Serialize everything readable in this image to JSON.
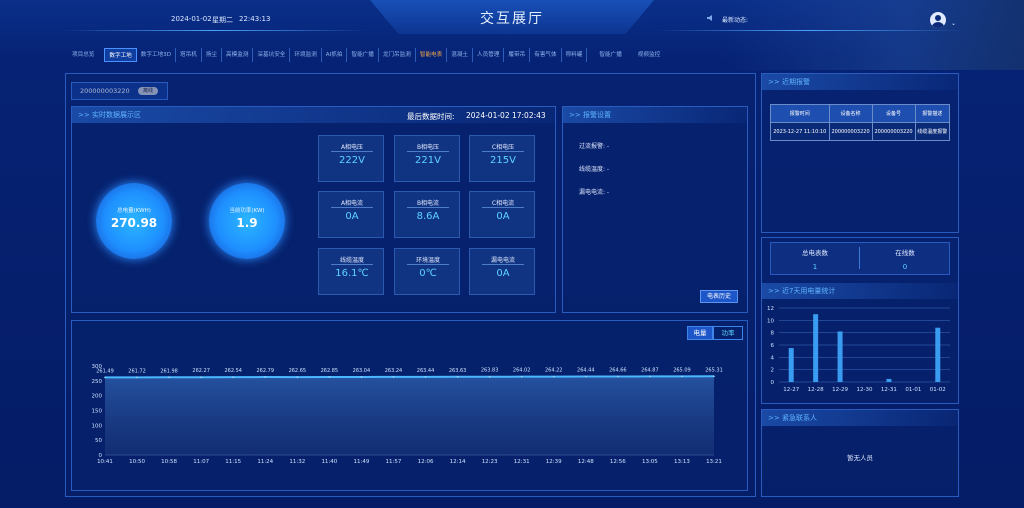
{
  "header": {
    "title": "交互展厅",
    "date": "2024-01-02",
    "weekday": "星期二",
    "time": "22:43:13",
    "news_label": "最新动态:"
  },
  "nav": {
    "items": [
      {
        "label": "项目总览",
        "state": "normal"
      },
      {
        "label": "数字工地",
        "state": "active"
      },
      {
        "label": "数字工地3D",
        "state": "normal"
      },
      {
        "label": "塔吊机",
        "state": "normal"
      },
      {
        "label": "扬尘",
        "state": "normal"
      },
      {
        "label": "高模监测",
        "state": "normal"
      },
      {
        "label": "深基坑安全",
        "state": "normal"
      },
      {
        "label": "环境监测",
        "state": "normal"
      },
      {
        "label": "AI抓拍",
        "state": "normal"
      },
      {
        "label": "智能广播",
        "state": "normal"
      },
      {
        "label": "龙门吊监测",
        "state": "normal"
      },
      {
        "label": "智能电表",
        "state": "orange"
      },
      {
        "label": "混凝土",
        "state": "normal"
      },
      {
        "label": "人员管理",
        "state": "normal"
      },
      {
        "label": "履带吊",
        "state": "normal"
      },
      {
        "label": "有害气体",
        "state": "normal"
      },
      {
        "label": "称料罐",
        "state": "normal"
      },
      {
        "label": "智能广播",
        "state": "plain"
      },
      {
        "label": "视频监控",
        "state": "plain"
      }
    ]
  },
  "device": {
    "id": "200000003220",
    "status": "离线"
  },
  "realtime": {
    "title": ">> 实时数据展示区",
    "last_time_label": "最后数据时间:",
    "last_time": "2024-01-02 17:02:43",
    "total_energy_label": "总电量(KWH)",
    "total_energy": "270.98",
    "power_label": "当前功率(KW)",
    "power": "1.9",
    "metrics": [
      {
        "label": "A相电压",
        "value": "222V"
      },
      {
        "label": "B相电压",
        "value": "221V"
      },
      {
        "label": "C相电压",
        "value": "215V"
      },
      {
        "label": "A相电流",
        "value": "0A"
      },
      {
        "label": "B相电流",
        "value": "8.6A"
      },
      {
        "label": "C相电流",
        "value": "0A"
      },
      {
        "label": "线缆温度",
        "value": "16.1℃"
      },
      {
        "label": "环境温度",
        "value": "0℃"
      },
      {
        "label": "漏电电流",
        "value": "0A"
      }
    ]
  },
  "alarm_settings": {
    "title": ">> 报警设置",
    "over_current": "过流报警:  -",
    "cable_temp": "线缆温度:  -",
    "leakage": "漏电电流:  -",
    "history_button": "电表历史"
  },
  "recent_alarms": {
    "title": ">> 近期报警",
    "columns": [
      "报警时间",
      "设备名称",
      "设备号",
      "报警描述"
    ],
    "rows": [
      [
        "2023-12-27 11:10:10",
        "200000003220",
        "200000003220",
        "线缆温度报警"
      ]
    ]
  },
  "counts": {
    "total_label": "总电表数",
    "total": "1",
    "online_label": "在线数",
    "online": "0"
  },
  "weekly": {
    "title": ">> 近7天用电量统计"
  },
  "contacts": {
    "title": ">> 紧急联系人",
    "empty": "暂无人员"
  },
  "chart_tabs": {
    "energy": "电量",
    "power": "功率"
  },
  "colors": {
    "accent": "#5cd3ff",
    "panel_border": "#2a5bbf",
    "orange": "#f0a54a"
  },
  "chart_data": [
    {
      "type": "area",
      "x": [
        "10:41",
        "10:50",
        "10:58",
        "11:07",
        "11:15",
        "11:24",
        "11:32",
        "11:40",
        "11:49",
        "11:57",
        "12:06",
        "12:14",
        "12:23",
        "12:31",
        "12:39",
        "12:48",
        "12:56",
        "13:05",
        "13:13",
        "13:21"
      ],
      "values": [
        261.49,
        261.72,
        261.98,
        262.27,
        262.54,
        262.79,
        262.65,
        262.85,
        263.04,
        263.24,
        263.44,
        263.63,
        263.83,
        264.02,
        264.22,
        264.44,
        264.66,
        264.87,
        265.09,
        265.31
      ],
      "ylim": [
        0,
        300
      ],
      "yticks": [
        0,
        50,
        100,
        150,
        200,
        250,
        300
      ],
      "grid": false
    },
    {
      "type": "bar",
      "categories": [
        "12-27",
        "12-28",
        "12-29",
        "12-30",
        "12-31",
        "01-01",
        "01-02"
      ],
      "values": [
        5.5,
        11,
        8.2,
        0,
        0.5,
        0,
        8.8
      ],
      "ylim": [
        0,
        12
      ],
      "yticks": [
        0,
        2,
        4,
        6,
        8,
        10,
        12
      ],
      "grid": true
    }
  ]
}
